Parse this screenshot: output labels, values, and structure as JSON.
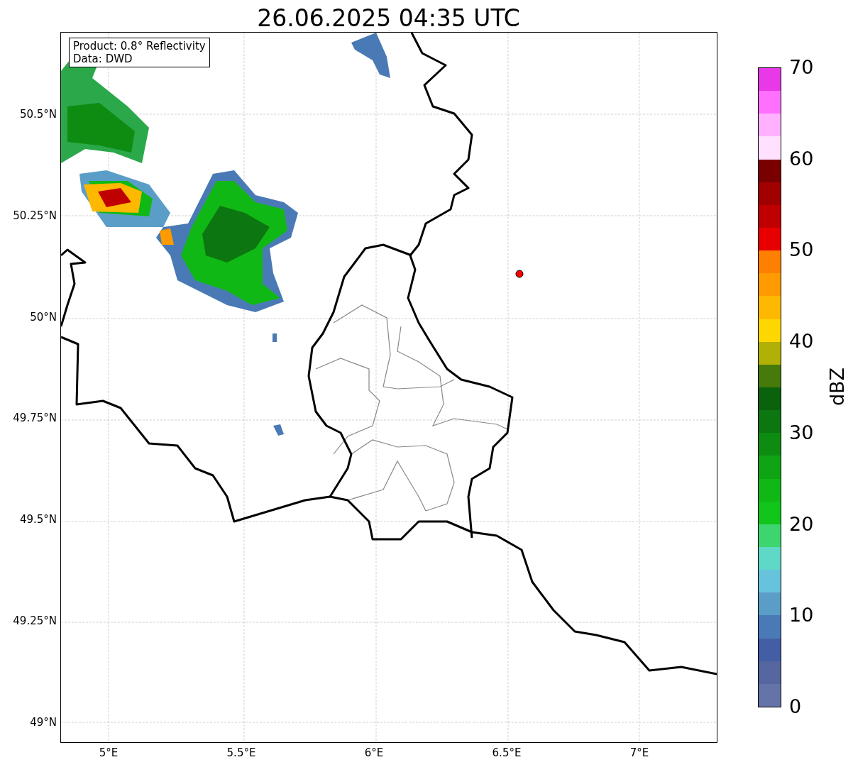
{
  "title": "26.06.2025 04:35 UTC",
  "info_box": [
    "Product: 0.8° Reflectivity",
    "Data: DWD"
  ],
  "y_ticks": [
    "50.5°N",
    "50.25°N",
    "50°N",
    "49.75°N",
    "49.5°N",
    "49.25°N",
    "49°N"
  ],
  "x_ticks": [
    "5°E",
    "5.5°E",
    "6°E",
    "6.5°E",
    "7°E"
  ],
  "colorbar": {
    "label": "dBZ",
    "ticks": [
      "70",
      "60",
      "50",
      "40",
      "30",
      "20",
      "10",
      "0"
    ],
    "segments": [
      {
        "color": "#e838e8"
      },
      {
        "color": "#ff70ff"
      },
      {
        "color": "#ffb0ff"
      },
      {
        "color": "#ffe0ff"
      },
      {
        "color": "#7a0000"
      },
      {
        "color": "#a00000"
      },
      {
        "color": "#c00000"
      },
      {
        "color": "#e80000"
      },
      {
        "color": "#ff7f00"
      },
      {
        "color": "#ff9a00"
      },
      {
        "color": "#ffb800"
      },
      {
        "color": "#ffd700"
      },
      {
        "color": "#b0b005"
      },
      {
        "color": "#467a0b"
      },
      {
        "color": "#0a620c"
      },
      {
        "color": "#0c7610"
      },
      {
        "color": "#0e8c12"
      },
      {
        "color": "#0fa413"
      },
      {
        "color": "#10b816"
      },
      {
        "color": "#11c51a"
      },
      {
        "color": "#3dd66e"
      },
      {
        "color": "#60d8c8"
      },
      {
        "color": "#67c2dc"
      },
      {
        "color": "#5a9ec8"
      },
      {
        "color": "#4a7ab5"
      },
      {
        "color": "#435ea5"
      },
      {
        "color": "#5566a0"
      },
      {
        "color": "#6574a8"
      }
    ]
  }
}
